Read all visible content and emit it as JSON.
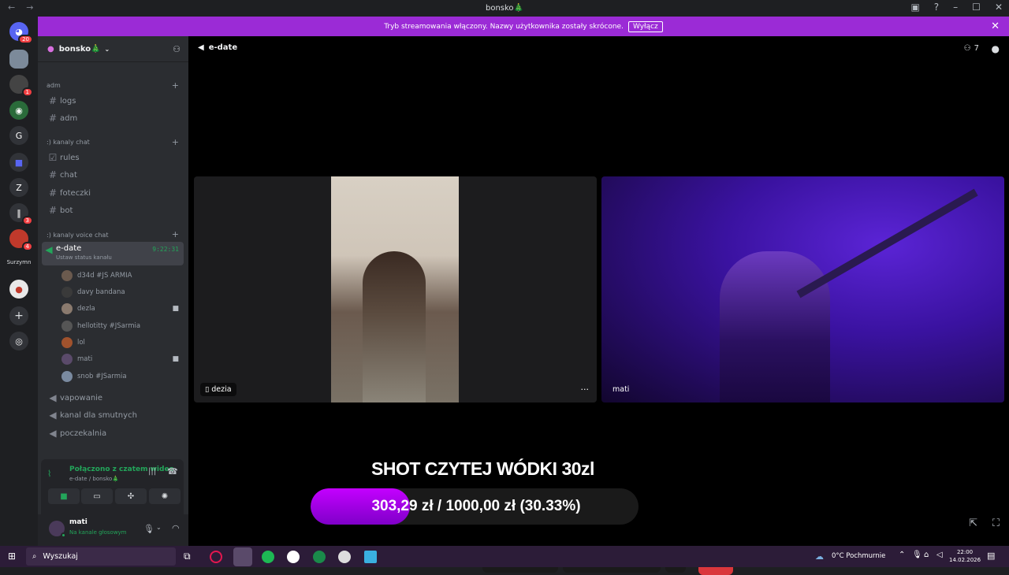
{
  "window": {
    "title": "bonsko🎄"
  },
  "banner": {
    "text": "Tryb streamowania włączony. Nazwy użytkownika zostały skrócone.",
    "button": "Wyłącz"
  },
  "guilds": {
    "badges": [
      "20",
      "1",
      "3",
      "4"
    ],
    "letter": "Z",
    "label": "Surzymn"
  },
  "server": {
    "name": "bonsko🎄"
  },
  "categories": [
    {
      "name": "adm",
      "channels": [
        "logs",
        "adm"
      ]
    },
    {
      "name": ":) kanaly chat",
      "channels": [
        "rules",
        "chat",
        "foteczki",
        "bot"
      ]
    },
    {
      "name": ":) kanaly voice chat"
    }
  ],
  "voice_channel": {
    "name": "e-date",
    "timer": "9:22:31",
    "status": "Ustaw status kanału",
    "users": [
      {
        "name": "d34d #JS ARMIA",
        "camera": false
      },
      {
        "name": "davy bandana",
        "camera": false
      },
      {
        "name": "dezla",
        "camera": true
      },
      {
        "name": "hellotitty #JSarmia",
        "camera": false
      },
      {
        "name": "lol",
        "camera": false
      },
      {
        "name": "mati",
        "camera": true
      },
      {
        "name": "snob #JSarmia",
        "camera": false
      }
    ]
  },
  "other_voice": [
    "vapowanie",
    "kanal dla smutnych",
    "poczekalnia"
  ],
  "connection": {
    "status": "Połączono z czatem wideo",
    "location": "e-date / bonsko🎄"
  },
  "me": {
    "name": "mati",
    "status": "Na kanale głosowym"
  },
  "header": {
    "channel": "e-date",
    "members": "7"
  },
  "tiles": [
    {
      "name": "dezia"
    },
    {
      "name": "mati"
    }
  ],
  "overlay": {
    "title": "SHOT CZYTEJ WÓDKI 30zl",
    "progress_text": "303,29 zł / 1000,00 zł (30.33%)",
    "progress_fraction": 0.3033
  },
  "taskbar": {
    "search": "Wyszukaj",
    "weather": "0°C Pochmurnie",
    "time": "22:00",
    "date": "14.02.2026"
  },
  "colors": {
    "accent": "#9b2bd6",
    "progress": "#b200f0",
    "hangup": "#da373c",
    "online": "#23a55a"
  }
}
